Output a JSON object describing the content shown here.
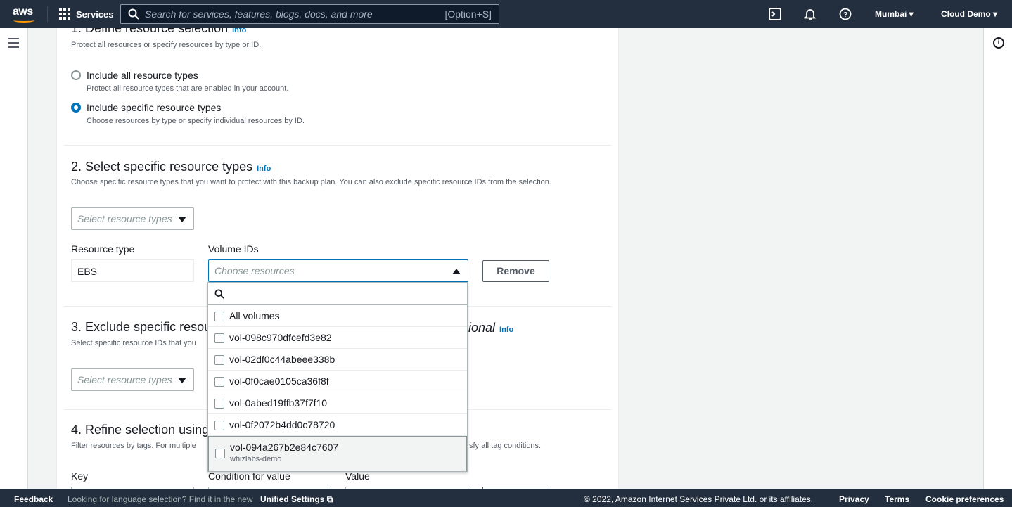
{
  "topbar": {
    "logo": "aws",
    "services": "Services",
    "search_placeholder": "Search for services, features, blogs, docs, and more",
    "shortcut": "[Option+S]",
    "region": "Mumbai",
    "account": "Cloud Demo"
  },
  "section1": {
    "title": "1. Define resource selection",
    "info": "Info",
    "desc": "Protect all resources or specify resources by type or ID.",
    "options": [
      {
        "label": "Include all resource types",
        "desc": "Protect all resource types that are enabled in your account.",
        "selected": false
      },
      {
        "label": "Include specific resource types",
        "desc": "Choose resources by type or specify individual resources by ID.",
        "selected": true
      }
    ]
  },
  "section2": {
    "title": "2. Select specific resource types",
    "info": "Info",
    "desc": "Choose specific resource types that you want to protect with this backup plan. You can also exclude specific resource IDs from the selection.",
    "select_placeholder": "Select resource types",
    "resource_type_label": "Resource type",
    "resource_type_value": "EBS",
    "volume_ids_label": "Volume IDs",
    "volume_placeholder": "Choose resources",
    "remove": "Remove"
  },
  "dropdown": {
    "options": [
      {
        "label": "All volumes"
      },
      {
        "label": "vol-098c970dfcefd3e82"
      },
      {
        "label": "vol-02df0c44abeee338b"
      },
      {
        "label": "vol-0f0cae0105ca36f8f"
      },
      {
        "label": "vol-0abed19ffb37f7f10"
      },
      {
        "label": "vol-0f2072b4dd0c78720"
      },
      {
        "label": "vol-094a267b2e84c7607",
        "sub": "whizlabs-demo"
      }
    ]
  },
  "section3": {
    "title_start": "3. Exclude specific resou",
    "title_end": "ional",
    "info": "Info",
    "desc_start": "Select specific resource IDs that you",
    "select_placeholder": "Select resource types"
  },
  "section4": {
    "title_start": "4. Refine selection using",
    "desc_start": "Filter resources by tags. For multiple",
    "desc_end": "sfy all tag conditions.",
    "key_label": "Key",
    "condition_label": "Condition for value",
    "value_label": "Value"
  },
  "footer": {
    "feedback": "Feedback",
    "lang_text": "Looking for language selection? Find it in the new",
    "unified": "Unified Settings",
    "copyright": "© 2022, Amazon Internet Services Private Ltd. or its affiliates.",
    "privacy": "Privacy",
    "terms": "Terms",
    "cookies": "Cookie preferences"
  }
}
